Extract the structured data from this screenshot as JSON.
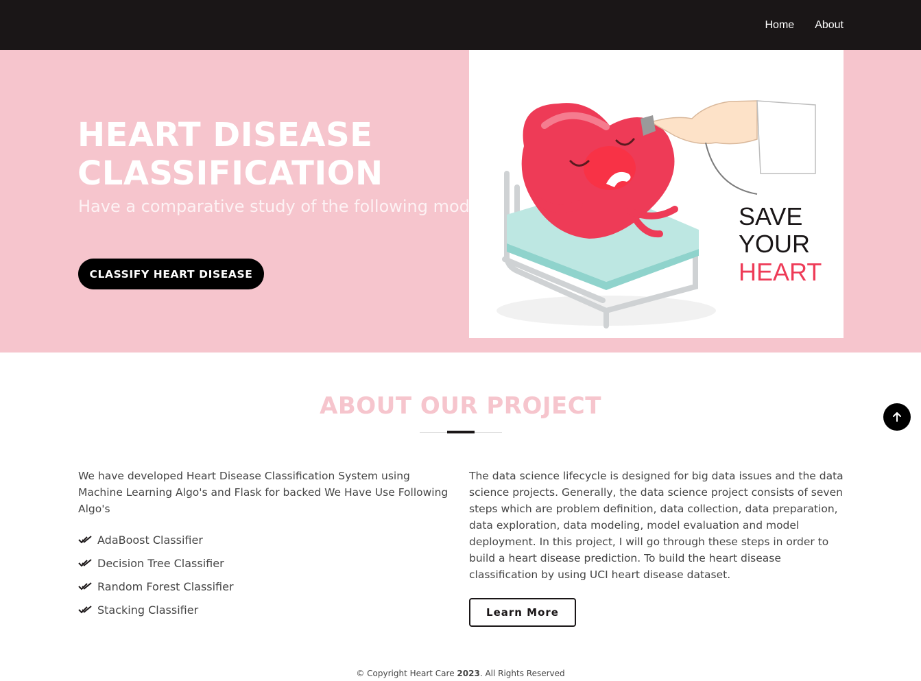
{
  "nav": {
    "items": [
      {
        "label": "Home"
      },
      {
        "label": "About"
      }
    ]
  },
  "hero": {
    "title_line1": "HEART DISEASE",
    "title_line2": "CLASSIFICATION",
    "subtitle": "Have a comparative study of the following models!!",
    "cta_label": "CLASSIFY HEART DISEASE",
    "image": {
      "text_line1": "SAVE",
      "text_line2": "YOUR",
      "text_line3": "HEART"
    }
  },
  "about": {
    "title": "ABOUT OUR PROJECT",
    "intro": "We have developed Heart Disease Classification System using Machine Learning Algo's and Flask for backed We Have Use Following Algo's",
    "algorithms": [
      {
        "label": "AdaBoost Classifier"
      },
      {
        "label": "Decision Tree Classifier"
      },
      {
        "label": "Random Forest Classifier"
      },
      {
        "label": "Stacking Classifier"
      }
    ],
    "description": "The data science lifecycle is designed for big data issues and the data science projects. Generally, the data science project consists of seven steps which are problem definition, data collection, data preparation, data exploration, data modeling, model evaluation and model deployment. In this project, I will go through these steps in order to build a heart disease prediction. To build the heart disease classification by using UCI heart disease dataset.",
    "learn_more_label": "Learn More"
  },
  "footer": {
    "prefix": "© Copyright Heart Care ",
    "year": "2023",
    "suffix": ". All Rights Reserved"
  },
  "colors": {
    "header_bg": "#1a1617",
    "hero_bg": "#f6c5cd",
    "accent_pink": "#f6c5cd",
    "heart_red": "#ee3b57",
    "button_bg": "#000000"
  }
}
